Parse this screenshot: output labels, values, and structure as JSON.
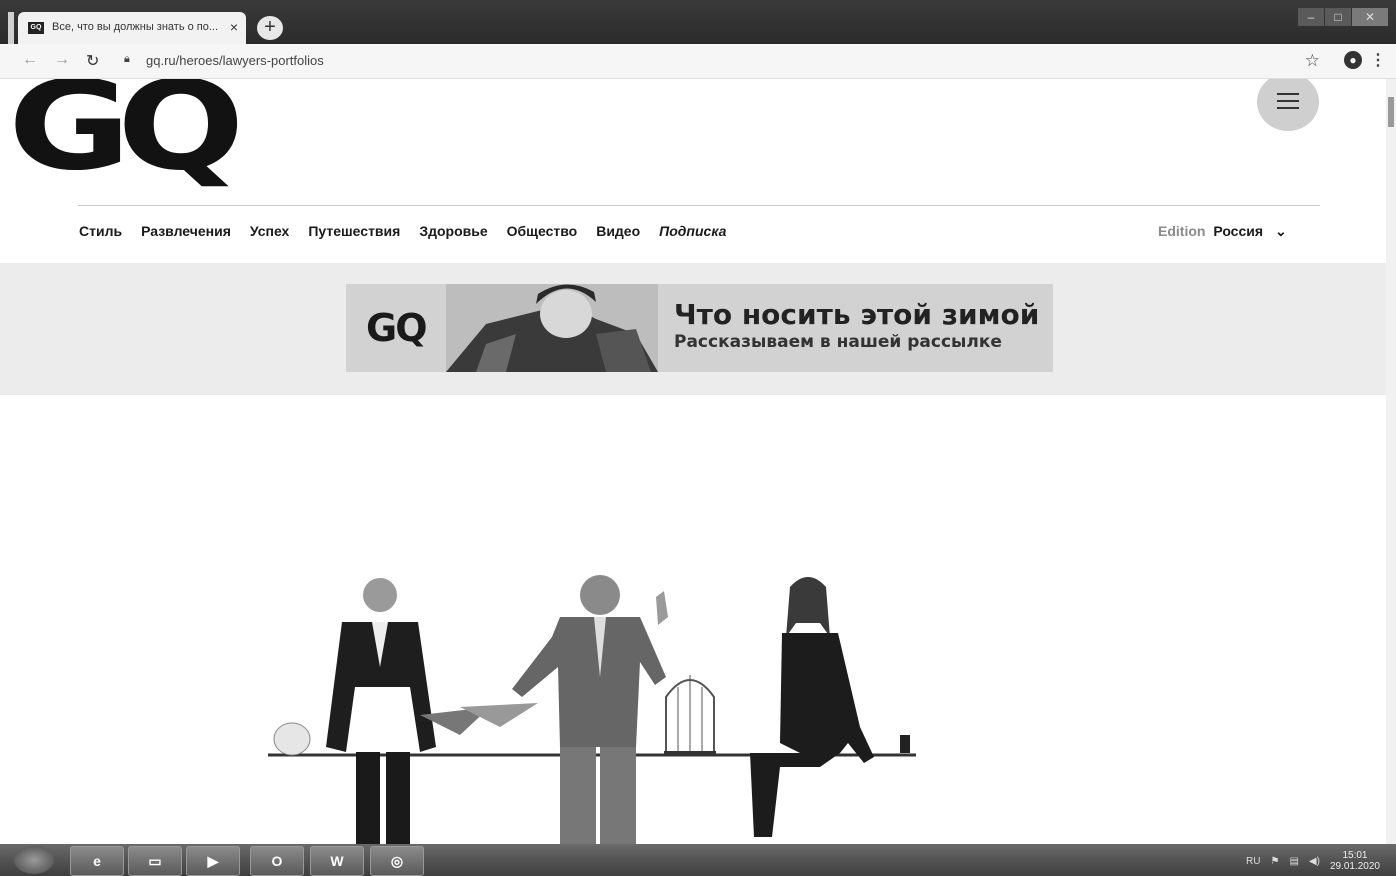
{
  "browser": {
    "tab_title": "Все, что вы должны знать о по...",
    "tab_favicon": "GQ",
    "url": "gq.ru/heroes/lawyers-portfolios",
    "icons": [
      "back-icon",
      "forward-icon",
      "reload-icon",
      "lock-icon",
      "star-icon",
      "account-icon",
      "kebab-menu-icon"
    ]
  },
  "site": {
    "logo": "GQ",
    "nav": [
      "Стиль",
      "Развлечения",
      "Успех",
      "Путешествия",
      "Здоровье",
      "Общество",
      "Видео",
      "Подписка"
    ],
    "edition_label": "Edition",
    "edition_value": "Россия"
  },
  "banner": {
    "logo": "GQ",
    "headline": "Что носить этой зимой",
    "subline": "Рассказываем в нашей рассылке"
  },
  "taskbar": {
    "items": [
      "start-orb",
      "internet-explorer",
      "file-explorer",
      "media-player",
      "outlook",
      "word",
      "chrome"
    ],
    "language": "RU",
    "time": "15:01",
    "date": "29.01.2020"
  }
}
